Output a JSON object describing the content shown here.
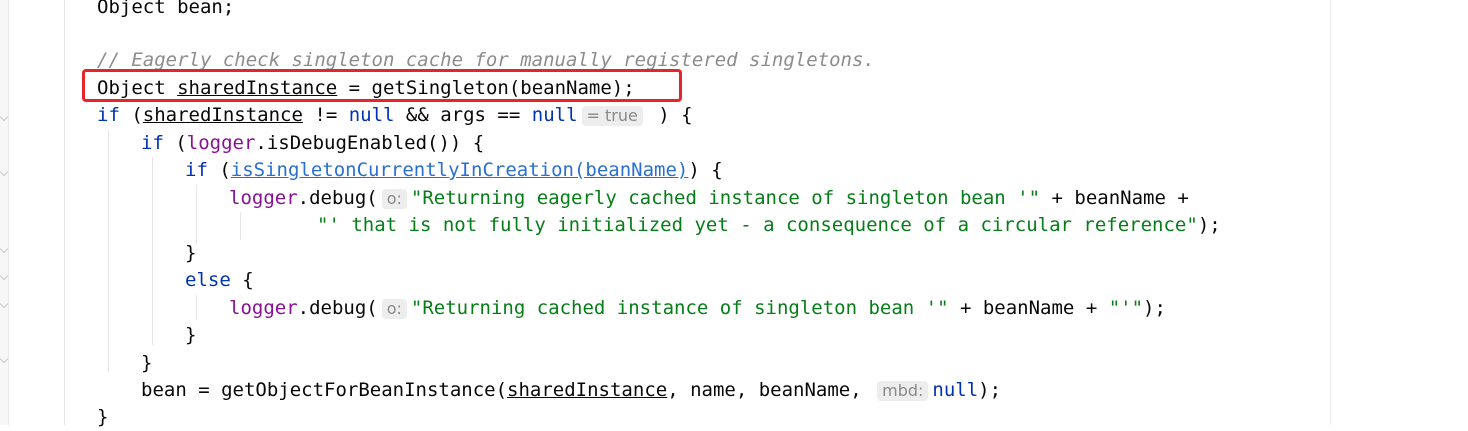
{
  "editor": {
    "language": "java",
    "lines": {
      "l0_text": "Object bean;",
      "comment": "// Eagerly check singleton cache for manually registered singletons.",
      "l2_type": "Object ",
      "l2_var": "sharedInstance",
      "l2_rest": " = getSingleton(beanName);",
      "l3_if": "if",
      "l3_open": " (",
      "l3_var": "sharedInstance",
      "l3_ne": " != ",
      "l3_null": "null",
      "l3_rest": " && args == ",
      "l3_null2": "null",
      "l3_hint": "= true",
      "l3_end": " ) {",
      "l4_if": "if",
      "l4_open": " (",
      "l4_logger": "logger",
      "l4_rest": ".isDebugEnabled()) {",
      "l5_if": "if",
      "l5_open": " (",
      "l5_call": "isSingletonCurrentlyInCreation(beanName)",
      "l5_rest": ") {",
      "l6_logger": "logger",
      "l6_call": ".debug(",
      "l6_hint": "o:",
      "l6_str": "\"Returning eagerly cached instance of singleton bean '\"",
      "l6_rest": " + beanName +",
      "l7_str": "\"' that is not fully initialized yet - a consequence of a circular reference\"",
      "l7_rest": ");",
      "l8_brace": "}",
      "l9_else": "else",
      "l9_rest": " {",
      "l10_logger": "logger",
      "l10_call": ".debug(",
      "l10_hint": "o:",
      "l10_str": "\"Returning cached instance of singleton bean '\"",
      "l10_mid": " + beanName + ",
      "l10_str2": "\"'\"",
      "l10_rest": ");",
      "l11_brace": "}",
      "l12_brace": "}",
      "l13_a": "bean = getObjectForBeanInstance(",
      "l13_var": "sharedInstance",
      "l13_b": ", name, beanName, ",
      "l13_hint": "mbd:",
      "l13_null": "null",
      "l13_c": ");",
      "l14_brace": "}"
    }
  },
  "annotation": {
    "highlight_color": "#e8242b"
  }
}
